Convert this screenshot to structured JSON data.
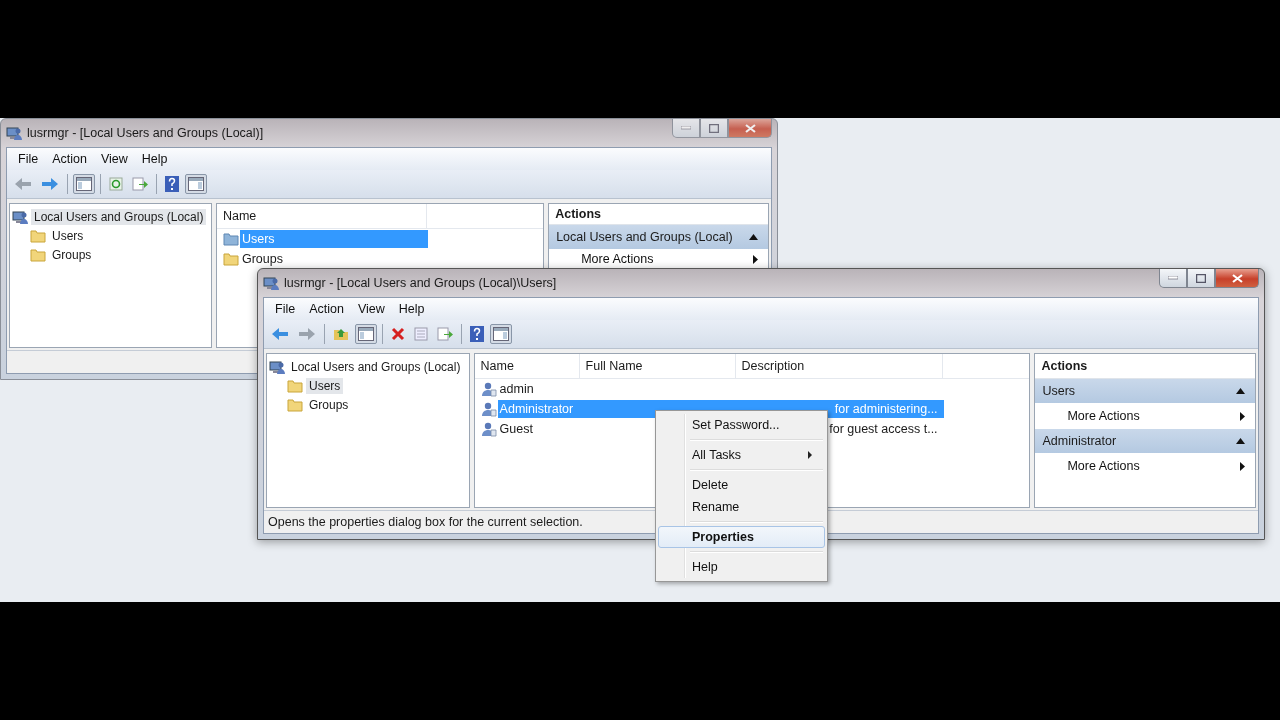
{
  "windows": [
    {
      "title": "lusrmgr - [Local Users and Groups (Local)]",
      "active": false,
      "menu": [
        "File",
        "Action",
        "View",
        "Help"
      ],
      "tree": {
        "label": "Local Users and Groups (Local)",
        "selected": true,
        "children": [
          {
            "label": "Users",
            "selected": false
          },
          {
            "label": "Groups",
            "selected": false
          }
        ]
      },
      "list": {
        "columns": [
          "Name"
        ],
        "rows": [
          {
            "kind": "folder",
            "name": "Users",
            "selected": true
          },
          {
            "kind": "folder",
            "name": "Groups",
            "selected": false
          }
        ]
      },
      "actions": {
        "title": "Actions",
        "groups": [
          {
            "label": "Local Users and Groups (Local)",
            "expanded": true,
            "items": [
              "More Actions"
            ]
          }
        ]
      }
    },
    {
      "title": "lusrmgr - [Local Users and Groups (Local)\\Users]",
      "active": true,
      "menu": [
        "File",
        "Action",
        "View",
        "Help"
      ],
      "tree": {
        "label": "Local Users and Groups (Local)",
        "selected": false,
        "children": [
          {
            "label": "Users",
            "selected": true
          },
          {
            "label": "Groups",
            "selected": false
          }
        ]
      },
      "list": {
        "columns": [
          "Name",
          "Full Name",
          "Description"
        ],
        "rows": [
          {
            "kind": "user",
            "name": "admin",
            "selected": false
          },
          {
            "kind": "user",
            "name": "Administrator",
            "description": "for administering...",
            "selected": true
          },
          {
            "kind": "user",
            "name": "Guest",
            "description": "for guest access t...",
            "selected": false
          }
        ]
      },
      "actions": {
        "title": "Actions",
        "groups": [
          {
            "label": "Users",
            "expanded": true,
            "items": [
              "More Actions"
            ]
          },
          {
            "label": "Administrator",
            "expanded": true,
            "items": [
              "More Actions"
            ]
          }
        ]
      },
      "status_bar": "Opens the properties dialog box for the current selection."
    }
  ],
  "context_menu": [
    {
      "label": "Set Password...",
      "submenu": false,
      "default": false,
      "selected": false,
      "separator_after": true
    },
    {
      "label": "All Tasks",
      "submenu": true,
      "default": false,
      "selected": false,
      "separator_after": true
    },
    {
      "label": "Delete",
      "submenu": false,
      "default": false,
      "selected": false,
      "separator_after": false
    },
    {
      "label": "Rename",
      "submenu": false,
      "default": false,
      "selected": false,
      "separator_after": true
    },
    {
      "label": "Properties",
      "submenu": false,
      "default": true,
      "selected": true,
      "separator_after": true
    },
    {
      "label": "Help",
      "submenu": false,
      "default": false,
      "selected": false,
      "separator_after": false
    }
  ]
}
